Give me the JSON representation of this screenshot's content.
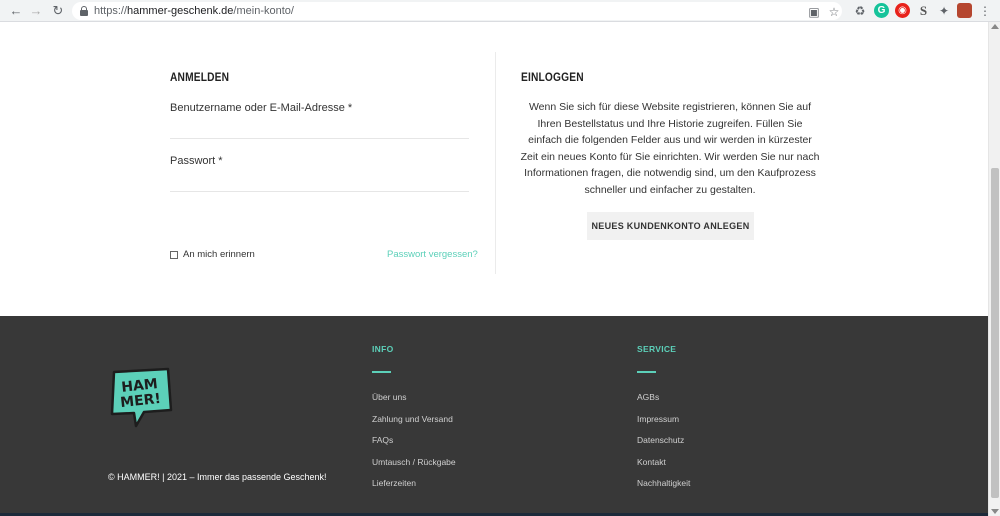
{
  "browser": {
    "url_prefix": "https://",
    "url_host": "hammer-geschenk.de",
    "url_path": "/mein-konto/",
    "back_icon": "back-arrow-icon",
    "forward_icon": "forward-arrow-icon",
    "reload_icon": "reload-icon",
    "extensions": [
      "translate-icon",
      "star-icon",
      "recycle-icon",
      "grammarly-icon",
      "adblock-icon",
      "s-extension-icon",
      "puzzle-icon",
      "profile-avatar",
      "menu-dots-icon"
    ]
  },
  "login": {
    "title": "ANMELDEN",
    "username_label": "Benutzername oder E-Mail-Adresse *",
    "username_value": "",
    "password_label": "Passwort *",
    "password_value": "",
    "remember_label": "An mich erinnern",
    "remember_checked": false,
    "forgot_link": "Passwort vergessen?"
  },
  "register": {
    "title": "EINLOGGEN",
    "intro": "Wenn Sie sich für diese Website registrieren, können Sie auf Ihren Bestellstatus und Ihre Historie zugreifen. Füllen Sie einfach die folgenden Felder aus und wir werden in kürzester Zeit ein neues Konto für Sie einrichten. Wir werden Sie nur nach Informationen fragen, die notwendig sind, um den Kaufprozess schneller und einfacher zu gestalten.",
    "button_label": "NEUES KUNDENKONTO ANLEGEN"
  },
  "footer": {
    "copyright": "© HAMMER! | 2021 – Immer das passende Geschenk!",
    "logo_text_line1": "HAM",
    "logo_text_line2": "MER!",
    "info": {
      "heading": "INFO",
      "links": [
        "Über uns",
        "Zahlung und Versand",
        "FAQs",
        "Umtausch / Rückgabe",
        "Lieferzeiten"
      ]
    },
    "service": {
      "heading": "SERVICE",
      "links": [
        "AGBs",
        "Impressum",
        "Datenschutz",
        "Kontakt",
        "Nachhaltigkeit"
      ]
    }
  },
  "colors": {
    "accent": "#5cd0b9",
    "footer_bg": "#383838",
    "button_bg": "#f1f1f1"
  }
}
